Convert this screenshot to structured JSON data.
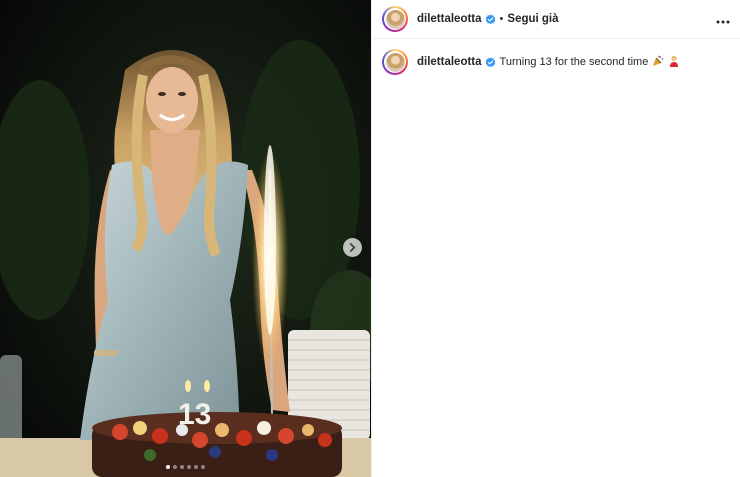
{
  "post": {
    "username": "dilettaleotta",
    "follow_separator": "•",
    "follow_label": "Segui già",
    "more_icon": "more-options-icon",
    "verified_icon": "verified-badge-icon",
    "caption": {
      "username": "dilettaleotta",
      "text": "Turning 13 for the second time",
      "emojis": [
        "party-popper-emoji",
        "woman-emoji"
      ]
    }
  },
  "media": {
    "cake_number": "13",
    "carousel": {
      "total_dots": 6,
      "active_index": 0
    }
  },
  "colors": {
    "verified_blue": "#3897f0",
    "text": "#262626",
    "divider": "#efefef"
  }
}
